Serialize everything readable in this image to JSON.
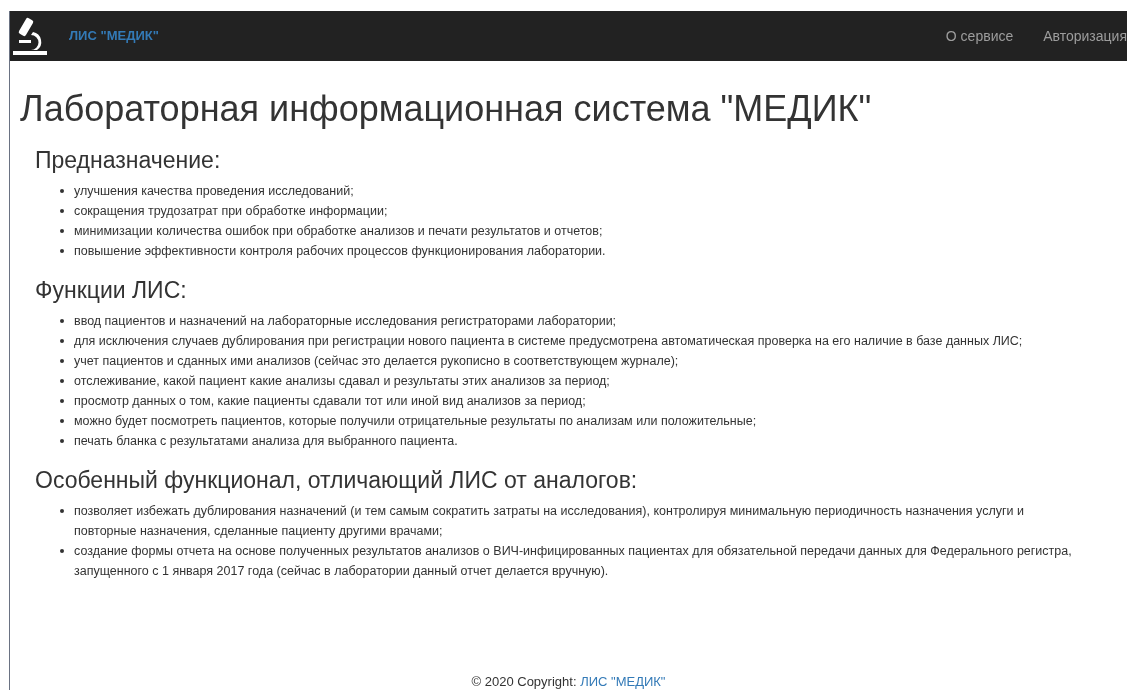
{
  "navbar": {
    "brand": "ЛИС \"МЕДИК\"",
    "links": [
      "О сервисе",
      "Авторизация"
    ]
  },
  "title": "Лабораторная информационная система \"МЕДИК\"",
  "sections": [
    {
      "heading": "Предназначение:",
      "items": [
        "улучшения качества проведения исследований;",
        "сокращения трудозатрат при обработке информации;",
        "минимизации количества ошибок при обработке анализов и печати результатов и отчетов;",
        "повышение эффективности контроля рабочих процессов функционирования лаборатории."
      ]
    },
    {
      "heading": "Функции ЛИС:",
      "items": [
        "ввод пациентов и назначений на лабораторные исследования регистраторами лаборатории;",
        "для исключения случаев дублирования при регистрации нового пациента в системе предусмотрена автоматическая проверка на его наличие в базе данных ЛИС;",
        "учет пациентов и сданных ими анализов (сейчас это делается рукописно в соответствующем журнале);",
        "отслеживание, какой пациент какие анализы сдавал и результаты этих анализов за период;",
        "просмотр данных о том, какие пациенты сдавали тот или иной вид анализов за период;",
        "можно будет посмотреть пациентов, которые получили отрицательные результаты по анализам или положительные;",
        "печать бланка с результатами анализа для выбранного пациента."
      ]
    },
    {
      "heading": "Особенный функционал, отличающий ЛИС от аналогов:",
      "items": [
        "позволяет избежать дублирования назначений (и тем самым сократить затраты на исследования), контролируя минимальную периодичность назначения услуги и повторные назначения, сделанные пациенту другими врачами;",
        "создание формы отчета на основе полученных результатов анализов о ВИЧ-инфицированных пациентах для обязательной передачи данных для Федерального регистра, запущенного с 1 января 2017 года (сейчас в лаборатории данный отчет делается вручную)."
      ]
    }
  ],
  "footer": {
    "text": "© 2020 Copyright:",
    "link": "ЛИС \"МЕДИК\""
  }
}
